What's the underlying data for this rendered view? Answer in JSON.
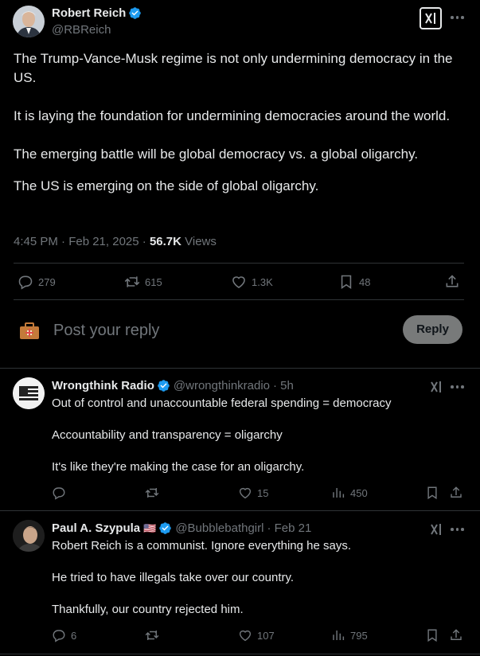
{
  "main_tweet": {
    "author_name": "Robert Reich",
    "handle": "@RBReich",
    "paragraphs": [
      "The Trump-Vance-Musk regime is not only undermining democracy in the US.",
      "It is laying the foundation for undermining democracies around the world.",
      "The emerging battle will be global democracy vs. a global oligarchy.",
      "The US is emerging on the side of global oligarchy."
    ],
    "time": "4:45 PM · Feb 21, 2025 · ",
    "views_count": "56.7K",
    "views_label": " Views",
    "replies": "279",
    "reposts": "615",
    "likes": "1.3K",
    "bookmarks": "48"
  },
  "composer": {
    "placeholder": "Post your reply",
    "reply_button": "Reply"
  },
  "replies": [
    {
      "author_name": "Wrongthink Radio",
      "handle": "@wrongthinkradio",
      "time": "· 5h",
      "paragraphs": [
        "Out of control and unaccountable federal spending = democracy",
        "Accountability and transparency = oligarchy",
        "It's like they're making the case for an oligarchy."
      ],
      "replies": "",
      "reposts": "",
      "likes": "15",
      "views": "450"
    },
    {
      "author_name": "Paul A. Szypula",
      "flag": "🇺🇸",
      "handle": "@Bubblebathgirl",
      "time": "· Feb 21",
      "paragraphs": [
        "Robert Reich is a communist. Ignore everything he says.",
        "He tried to have illegals take over our country.",
        "Thankfully, our country rejected him."
      ],
      "replies": "6",
      "reposts": "",
      "likes": "107",
      "views": "795"
    }
  ],
  "colors": {
    "background": "#000000",
    "text": "#e7e9ea",
    "muted": "#71767b",
    "verified": "#1d9bf0",
    "divider": "#2f3336",
    "reply_button_bg": "#787a7a"
  }
}
